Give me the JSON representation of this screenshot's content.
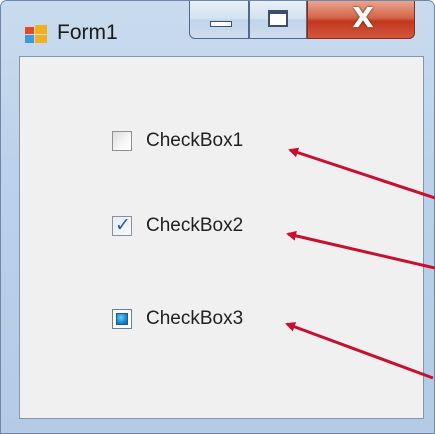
{
  "window": {
    "title": "Form1",
    "accent_close": "#c0381d"
  },
  "caption_buttons": {
    "minimize": "minimize-icon",
    "maximize": "maximize-icon",
    "close": "close-icon",
    "close_glyph": "X"
  },
  "checkboxes": [
    {
      "label": "CheckBox1",
      "state": "unchecked"
    },
    {
      "label": "CheckBox2",
      "state": "checked"
    },
    {
      "label": "CheckBox3",
      "state": "indeterminate"
    }
  ],
  "annotation_color": "#c8102e"
}
